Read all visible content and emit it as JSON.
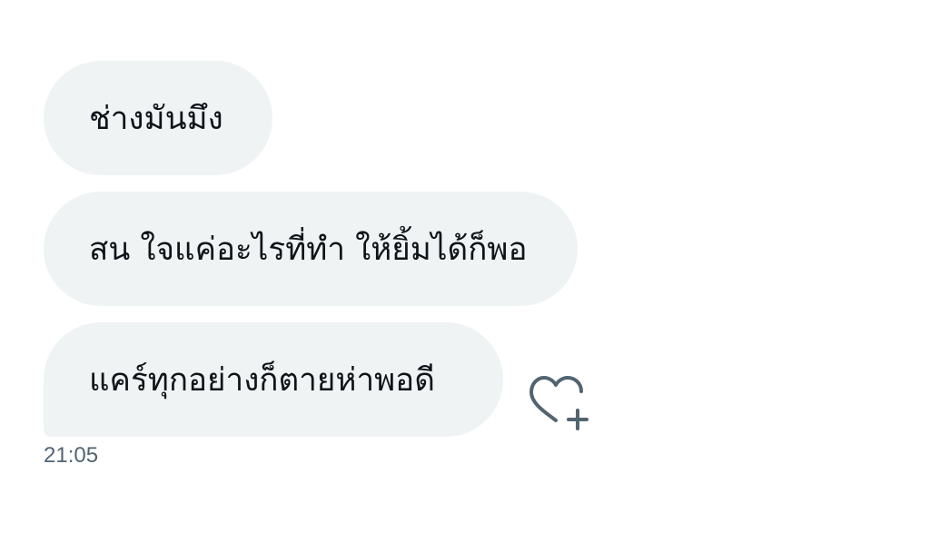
{
  "messages": [
    {
      "text": "ช่างมันมึง"
    },
    {
      "text": "สน ใจแค่อะไรที่ทำ ให้ยิ้มได้ก็พอ"
    },
    {
      "text": "แคร์ทุกอย่างก็ตายห่าพอดี"
    }
  ],
  "timestamp": "21:05",
  "reaction_icon": "heart-plus-icon",
  "colors": {
    "bubble_bg": "#eff3f4",
    "text": "#0f1419",
    "muted": "#536471"
  }
}
